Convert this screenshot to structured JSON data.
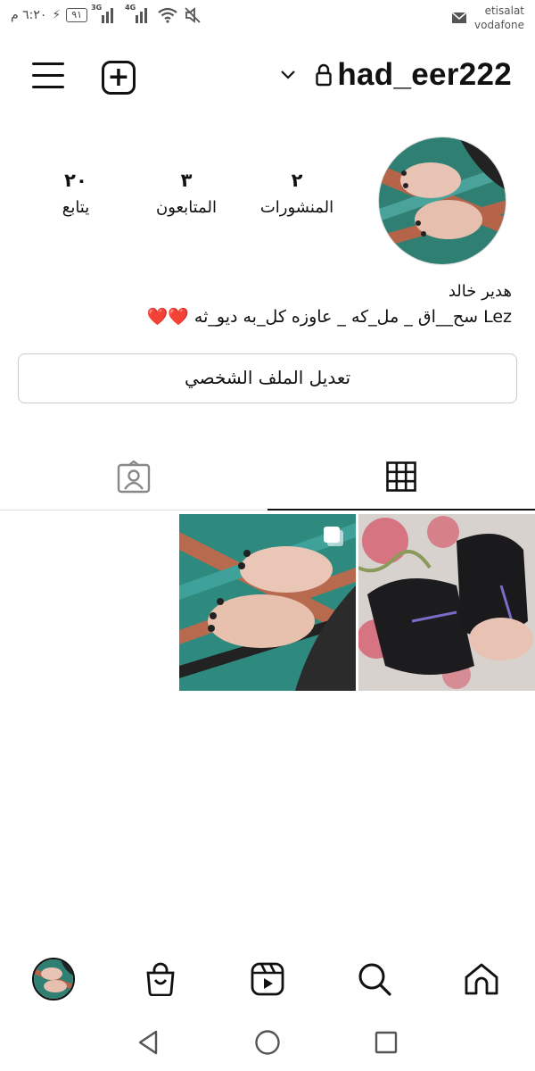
{
  "status_bar": {
    "time": "٦:٢٠ م",
    "battery": "٩١",
    "network_1": "3G",
    "network_2": "4G",
    "carrier_1": "etisalat",
    "carrier_2": "vodafone",
    "icons": [
      "charging-icon",
      "battery-icon",
      "signal-icon",
      "wifi-icon",
      "mute-icon",
      "mail-icon"
    ]
  },
  "header": {
    "username": "had_eer222",
    "icons": [
      "menu-icon",
      "add-post-icon",
      "chevron-down-icon",
      "lock-icon"
    ]
  },
  "profile": {
    "stats": [
      {
        "value": "٢",
        "label": "المنشورات"
      },
      {
        "value": "٣",
        "label": "المتابعون"
      },
      {
        "value": "٢٠",
        "label": "يتابع"
      }
    ],
    "display_name": "هدير خالد",
    "bio_text": "Lez سح__اق _ مل_كه _ عاوزه كل_به ديو_ثه",
    "bio_emoji": "❤️❤️",
    "edit_profile_label": "تعديل الملف الشخصي"
  },
  "tabs": [
    {
      "name": "grid",
      "icon": "grid-icon",
      "active": true
    },
    {
      "name": "tagged",
      "icon": "tagged-icon",
      "active": false
    }
  ],
  "posts": [
    {
      "type": "image",
      "icon": "multi-photo-icon"
    },
    {
      "type": "image"
    }
  ],
  "bottom_nav": [
    "home-icon",
    "search-icon",
    "reels-icon",
    "shop-icon",
    "profile-avatar"
  ],
  "system_nav": [
    "back-icon",
    "home-circle-icon",
    "recents-icon"
  ],
  "colors": {
    "accent": "#111111",
    "heart": "#e0182b",
    "border": "#cccccc"
  }
}
